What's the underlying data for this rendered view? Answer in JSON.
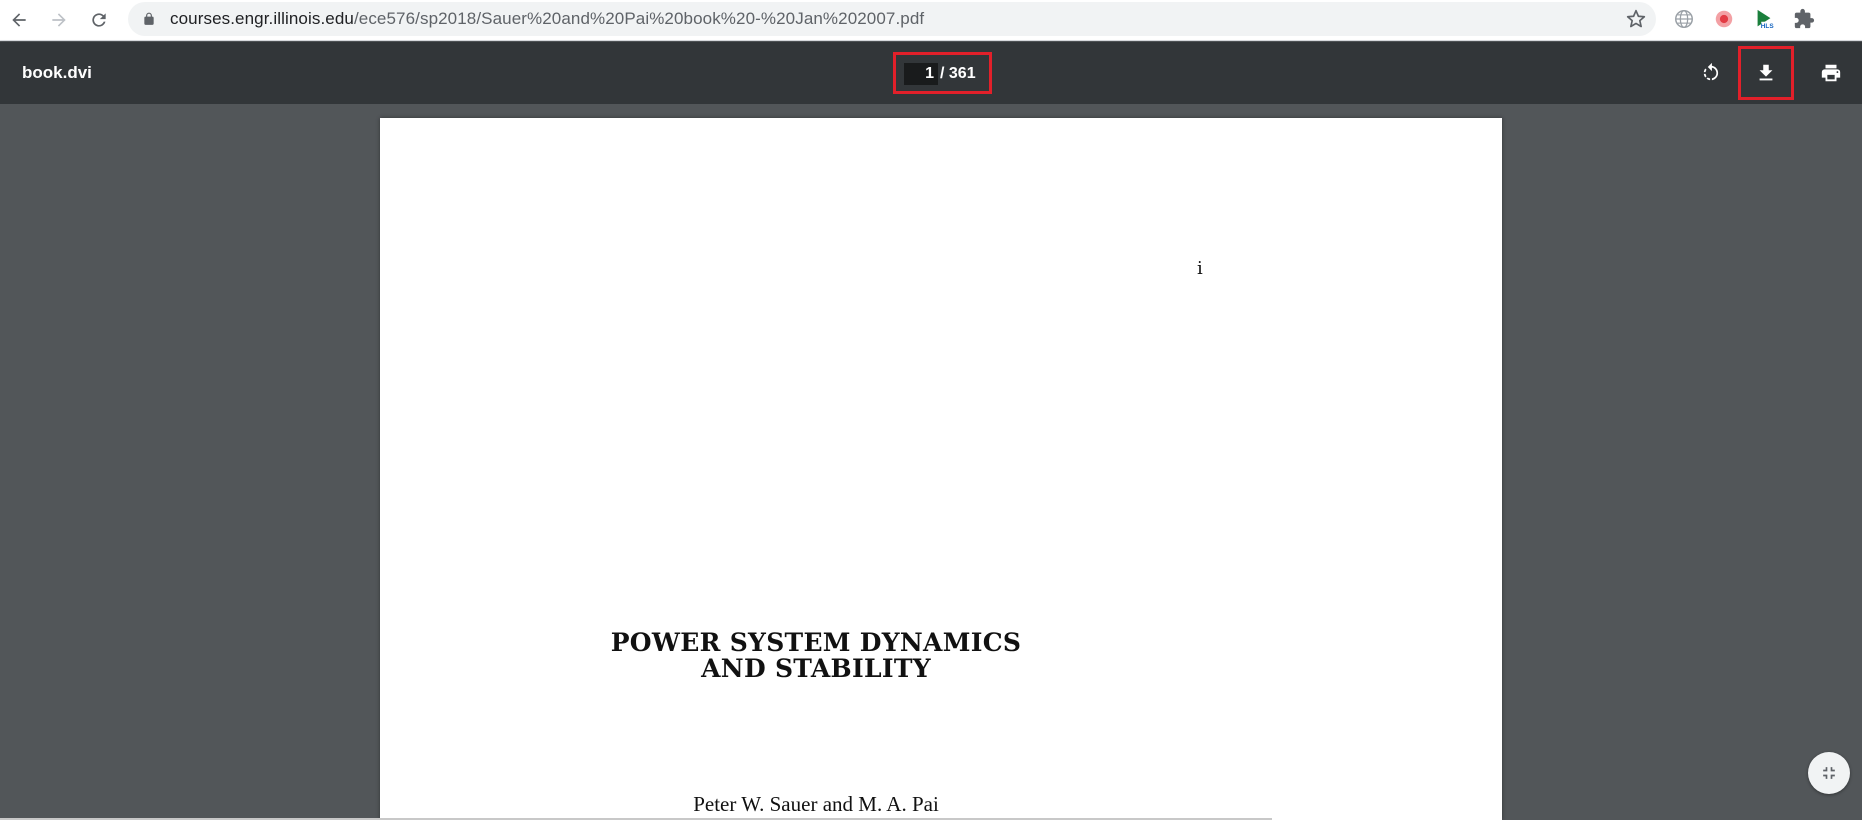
{
  "browser": {
    "url_host": "courses.engr.illinois.edu",
    "url_path": "/ece576/sp2018/Sauer%20and%20Pai%20book%20-%20Jan%202007.pdf",
    "icons": [
      "back-arrow-icon",
      "forward-arrow-icon",
      "reload-icon",
      "lock-icon",
      "star-icon",
      "globe-extension-icon",
      "record-extension-icon",
      "hls-extension-icon",
      "puzzle-extensions-icon"
    ]
  },
  "toolbar": {
    "title": "book.dvi",
    "current_page": "1",
    "page_total": "/ 361",
    "icons": [
      "rotate-icon",
      "download-icon",
      "print-icon"
    ],
    "highlight_color": "#e2202a"
  },
  "document": {
    "page_number": "i",
    "title_line1": "POWER SYSTEM DYNAMICS",
    "title_line2": "AND STABILITY",
    "authors": "Peter W. Sauer and M. A. Pai"
  },
  "viewer": {
    "icons": [
      "fit-to-page-icon"
    ]
  }
}
